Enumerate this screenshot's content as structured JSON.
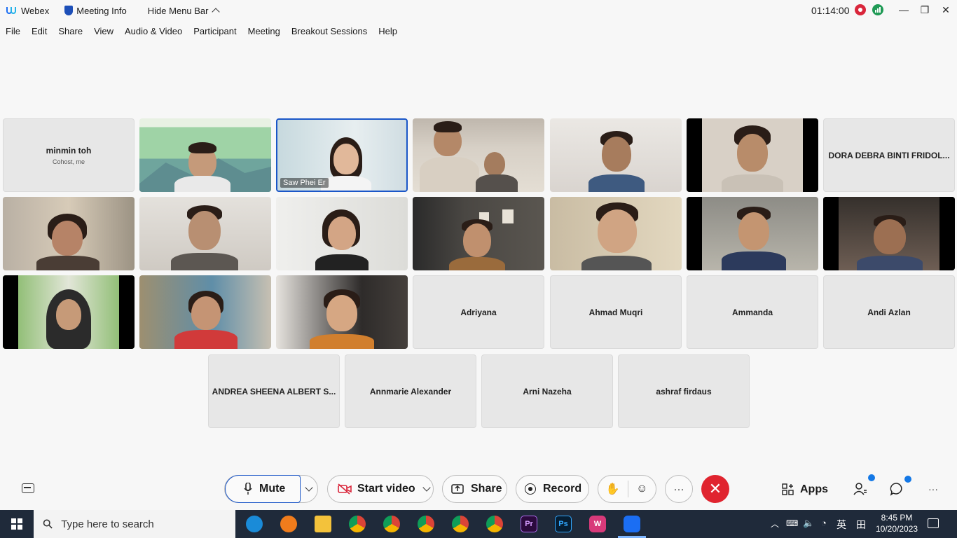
{
  "window": {
    "app_name": "Webex",
    "meeting_info_label": "Meeting Info",
    "hide_menu_label": "Hide Menu Bar",
    "timer": "01:14:00",
    "minimize": "—",
    "restore": "❐",
    "close": "✕"
  },
  "menu": [
    "File",
    "Edit",
    "Share",
    "View",
    "Audio & Video",
    "Participant",
    "Meeting",
    "Breakout Sessions",
    "Help"
  ],
  "participants": {
    "minmin": {
      "name": "minmin toh",
      "role": "Cohost, me"
    },
    "saw": {
      "name": "Saw Phei Er"
    },
    "dora": {
      "name": "DORA DEBRA BINTI FRIDOL..."
    },
    "adriyana": {
      "name": "Adriyana"
    },
    "ahmad": {
      "name": "Ahmad Muqri"
    },
    "ammanda": {
      "name": "Ammanda"
    },
    "andi": {
      "name": "Andi Azlan"
    },
    "andrea": {
      "name": "ANDREA SHEENA ALBERT S..."
    },
    "annmarie": {
      "name": "Annmarie Alexander"
    },
    "arni": {
      "name": "Arni Nazeha"
    },
    "ashraf": {
      "name": "ashraf firdaus"
    }
  },
  "toolbar": {
    "mute_label": "Mute",
    "start_video_label": "Start video",
    "share_label": "Share",
    "record_label": "Record",
    "apps_label": "Apps",
    "more_label": "···"
  },
  "taskbar": {
    "search_placeholder": "Type here to search",
    "time": "8:45 PM",
    "date": "10/20/2023",
    "ime": "英"
  },
  "colors": {
    "accent_blue": "#1a56c8",
    "end_call_red": "#e0242f",
    "recording_red": "#d9263b",
    "stats_green": "#1f9a55",
    "notification_blue": "#1478e6"
  }
}
